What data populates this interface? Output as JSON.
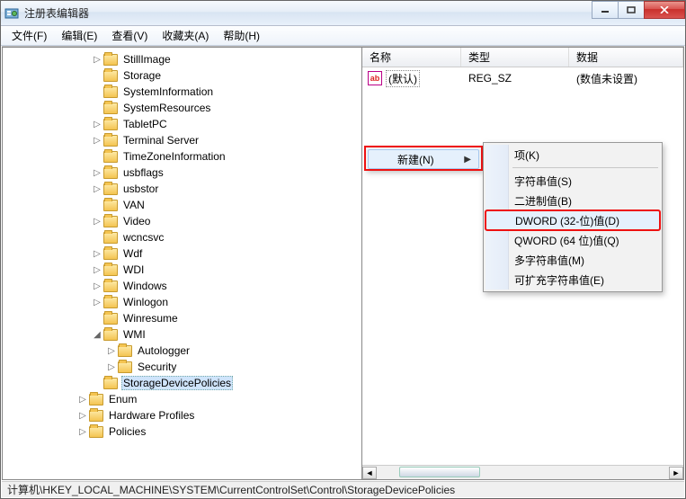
{
  "window": {
    "title": "注册表编辑器"
  },
  "menus": {
    "file": "文件(F)",
    "edit": "编辑(E)",
    "view": "查看(V)",
    "favorites": "收藏夹(A)",
    "help": "帮助(H)"
  },
  "list": {
    "columns": {
      "name": "名称",
      "type": "类型",
      "data": "数据"
    },
    "rows": [
      {
        "name": "(默认)",
        "type": "REG_SZ",
        "data": "(数值未设置)",
        "icon": "ab"
      }
    ]
  },
  "tree": {
    "items": [
      {
        "depth": 6,
        "exp": "closed",
        "label": "StillImage"
      },
      {
        "depth": 6,
        "exp": "none",
        "label": "Storage"
      },
      {
        "depth": 6,
        "exp": "none",
        "label": "SystemInformation"
      },
      {
        "depth": 6,
        "exp": "none",
        "label": "SystemResources"
      },
      {
        "depth": 6,
        "exp": "closed",
        "label": "TabletPC"
      },
      {
        "depth": 6,
        "exp": "closed",
        "label": "Terminal Server"
      },
      {
        "depth": 6,
        "exp": "none",
        "label": "TimeZoneInformation"
      },
      {
        "depth": 6,
        "exp": "closed",
        "label": "usbflags"
      },
      {
        "depth": 6,
        "exp": "closed",
        "label": "usbstor"
      },
      {
        "depth": 6,
        "exp": "none",
        "label": "VAN"
      },
      {
        "depth": 6,
        "exp": "closed",
        "label": "Video"
      },
      {
        "depth": 6,
        "exp": "none",
        "label": "wcncsvc"
      },
      {
        "depth": 6,
        "exp": "closed",
        "label": "Wdf"
      },
      {
        "depth": 6,
        "exp": "closed",
        "label": "WDI"
      },
      {
        "depth": 6,
        "exp": "closed",
        "label": "Windows"
      },
      {
        "depth": 6,
        "exp": "closed",
        "label": "Winlogon"
      },
      {
        "depth": 6,
        "exp": "none",
        "label": "Winresume"
      },
      {
        "depth": 6,
        "exp": "open",
        "label": "WMI"
      },
      {
        "depth": 7,
        "exp": "closed",
        "label": "Autologger"
      },
      {
        "depth": 7,
        "exp": "closed",
        "label": "Security"
      },
      {
        "depth": 6,
        "exp": "none",
        "label": "StorageDevicePolicies",
        "selected": true
      },
      {
        "depth": 5,
        "exp": "closed",
        "label": "Enum"
      },
      {
        "depth": 5,
        "exp": "closed",
        "label": "Hardware Profiles"
      },
      {
        "depth": 5,
        "exp": "closed",
        "label": "Policies"
      }
    ]
  },
  "context_primary": {
    "new_label": "新建(N)"
  },
  "context_sub": {
    "items": [
      {
        "id": "key",
        "label": "项(K)"
      },
      {
        "id": "string",
        "label": "字符串值(S)"
      },
      {
        "id": "binary",
        "label": "二进制值(B)"
      },
      {
        "id": "dword",
        "label": "DWORD (32-位)值(D)",
        "hl": true
      },
      {
        "id": "qword",
        "label": "QWORD (64 位)值(Q)"
      },
      {
        "id": "multi",
        "label": "多字符串值(M)"
      },
      {
        "id": "expand",
        "label": "可扩充字符串值(E)"
      }
    ]
  },
  "status": {
    "path": "计算机\\HKEY_LOCAL_MACHINE\\SYSTEM\\CurrentControlSet\\Control\\StorageDevicePolicies"
  }
}
